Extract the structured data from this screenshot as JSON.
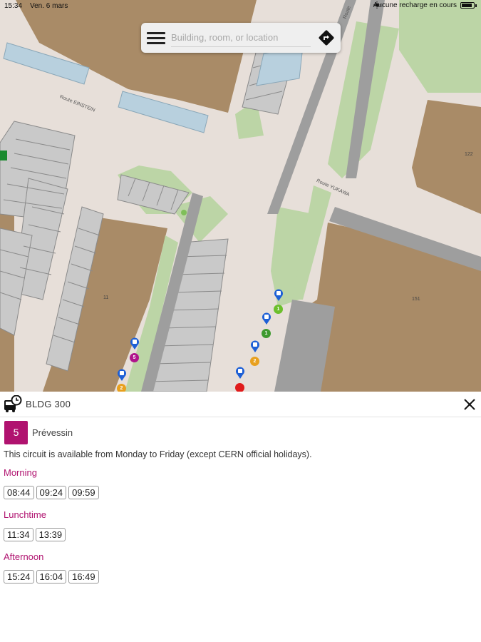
{
  "status_bar": {
    "time": "15:34",
    "date": "Ven. 6 mars",
    "charging": "Aucune recharge en cours"
  },
  "search": {
    "placeholder": "Building, room, or location"
  },
  "map": {
    "road_labels": [
      "Route EINSTEIN",
      "Route YUKAWA",
      "Route"
    ],
    "building_labels": [
      "122",
      "151",
      "11"
    ],
    "stops": [
      {
        "number": "1",
        "color": "#6cbf2c"
      },
      {
        "number": "1",
        "color": "#3e9a2f"
      },
      {
        "number": "2",
        "color": "#e8a01e"
      },
      {
        "number": "5",
        "color": "#b0148c"
      },
      {
        "number": "2",
        "color": "#e8a01e"
      },
      {
        "number": "",
        "color": "#e01b1b"
      }
    ]
  },
  "panel": {
    "title": "BLDG 300",
    "line": {
      "number": "5",
      "name": "Prévessin",
      "color": "#b0126f"
    },
    "availability": "This circuit is available from Monday to Friday (except CERN official holidays).",
    "accent_color": "#b0126f",
    "sections": [
      {
        "title": "Morning",
        "times": [
          "08:44",
          "09:24",
          "09:59"
        ]
      },
      {
        "title": "Lunchtime",
        "times": [
          "11:34",
          "13:39"
        ]
      },
      {
        "title": "Afternoon",
        "times": [
          "15:24",
          "16:04",
          "16:49"
        ]
      }
    ]
  },
  "icons": {
    "menu": "hamburger-menu-icon",
    "directions": "directions-icon",
    "bus_schedule": "bus-clock-icon",
    "close": "close-icon",
    "bus_stop": "bus-stop-marker-icon"
  }
}
